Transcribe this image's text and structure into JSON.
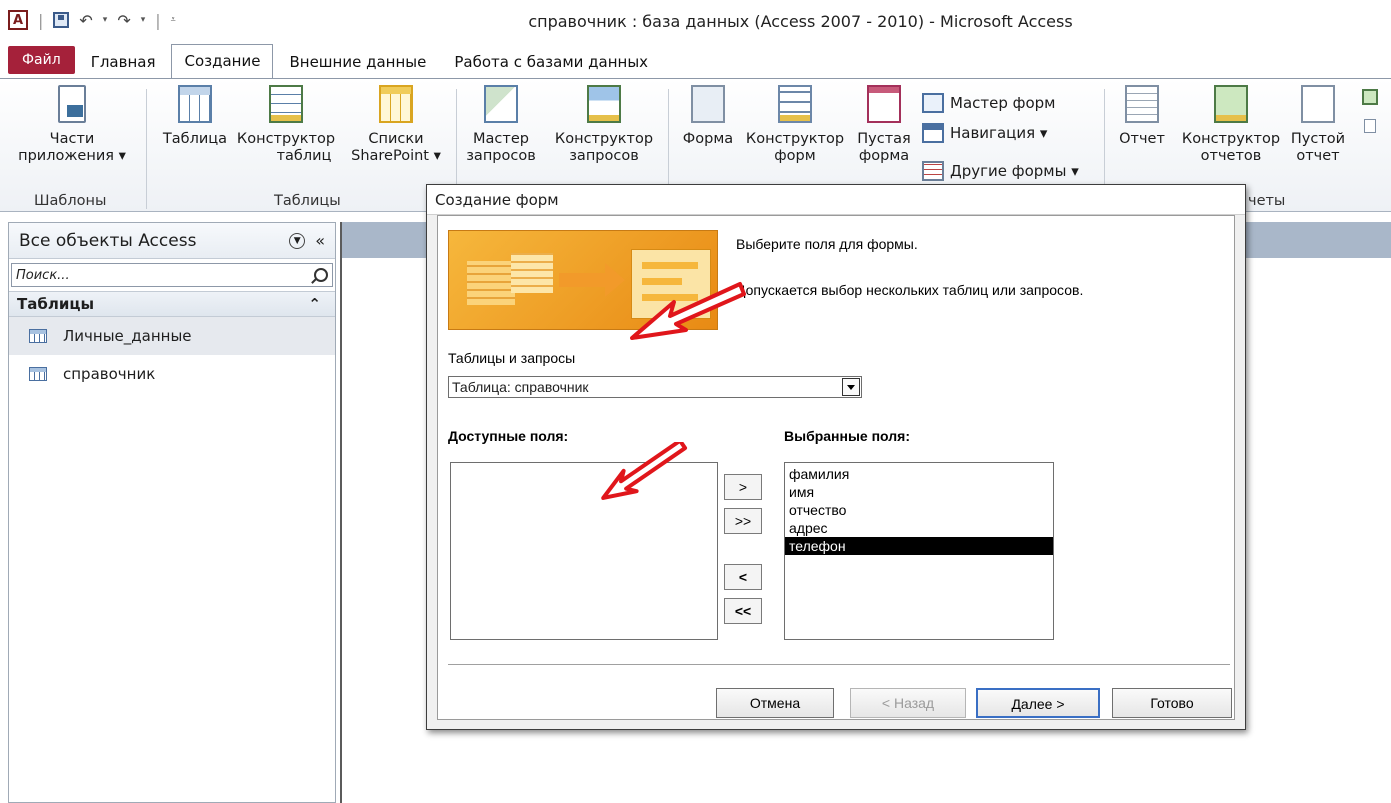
{
  "window": {
    "title": "справочник : база данных (Access 2007 - 2010)  -  Microsoft Access"
  },
  "ribbon_tabs": [
    "Файл",
    "Главная",
    "Создание",
    "Внешние данные",
    "Работа с базами данных"
  ],
  "ribbon": {
    "buttons": {
      "parts_l1": "Части",
      "parts_l2": "приложения ▾",
      "table": "Таблица",
      "tdesign_l1": "Конструктор",
      "tdesign_l2": "таблиц",
      "sp_l1": "Списки",
      "sp_l2": "SharePoint ▾",
      "qwiz_l1": "Мастер",
      "qwiz_l2": "запросов",
      "qdesign_l1": "Конструктор",
      "qdesign_l2": "запросов",
      "form": "Форма",
      "fdesign_l1": "Конструктор",
      "fdesign_l2": "форм",
      "blank_l1": "Пустая",
      "blank_l2": "форма",
      "form_wizard": "Мастер форм",
      "navigation": "Навигация ▾",
      "other_forms": "Другие формы ▾",
      "report": "Отчет",
      "rdesign_l1": "Конструктор",
      "rdesign_l2": "отчетов",
      "rblank_l1": "Пустой",
      "rblank_l2": "отчет"
    },
    "groups": {
      "templates": "Шаблоны",
      "tables": "Таблицы",
      "reports": "четы"
    }
  },
  "nav_pane": {
    "title": "Все объекты Access",
    "search_placeholder": "Поиск...",
    "group": "Таблицы",
    "items": [
      "Личные_данные",
      "справочник"
    ]
  },
  "dialog": {
    "title": "Создание форм",
    "intro": "Выберите поля для формы.",
    "hint": "Допускается выбор нескольких таблиц или запросов.",
    "tables_label": "Таблицы и запросы",
    "combo_value": "Таблица: справочник",
    "available_label": "Доступные поля:",
    "selected_label": "Выбранные поля:",
    "available_fields": [],
    "selected_fields": [
      "фамилия",
      "имя",
      "отчество",
      "адрес",
      "телефон"
    ],
    "selected_highlight": "телефон",
    "move_buttons": [
      ">",
      ">>",
      "<",
      "<<"
    ],
    "buttons": {
      "cancel": "Отмена",
      "back": "< Назад",
      "next": "Далее >",
      "finish": "Готово"
    }
  },
  "colors": {
    "file_tab": "#a5213a",
    "arrow": "#e0161b",
    "art_orange": "#f6b73c"
  }
}
